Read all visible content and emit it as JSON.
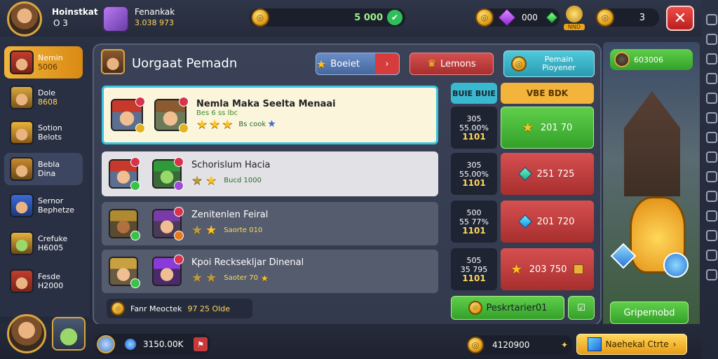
{
  "header": {
    "player_name": "Hoinstkat",
    "player_level": "O 3",
    "ally_name": "Fenankak",
    "ally_value": "3.038 973",
    "gold": "5 000",
    "gems": "000",
    "ticket_badge": "NND",
    "tokens": "3"
  },
  "sidebar": {
    "items": [
      {
        "label": "Nemin",
        "sub": "5006",
        "active": true
      },
      {
        "label": "Dole",
        "sub": "8608"
      },
      {
        "label": "Sotion",
        "sub": "Belots"
      },
      {
        "label": "Bebla",
        "sub": "Dina"
      },
      {
        "label": "Sernor",
        "sub": "Bephetze"
      },
      {
        "label": "Crefuke",
        "sub": "H6005"
      },
      {
        "label": "Fesde",
        "sub": "H2000"
      }
    ]
  },
  "panel": {
    "title": "Uorgaat Pemadn",
    "btn_select": "Boeiet",
    "btn_lemons": "Lemons",
    "btn_pemain": "Pemain Pioyener",
    "currency_right": "603006",
    "col_header_left": "BUIE BUIE",
    "col_header_right": "VBE BDK"
  },
  "rows": [
    {
      "title": "Nemla Maka Seelta Menaai",
      "sub": "Bes 6 ss lbc",
      "extra": "Bs cook",
      "stats": [
        "305",
        "55.00%",
        "1101"
      ],
      "price": "201 70",
      "stars": 3
    },
    {
      "title": "Schorislum Hacia",
      "sub": "",
      "extra": "Bucd 1000",
      "stats": [
        "305",
        "55.00%",
        "1101"
      ],
      "price": "251 725",
      "stars": 2
    },
    {
      "title": "Zenitenlen Feiral",
      "sub": "",
      "extra": "Saorte 010",
      "stats": [
        "500",
        "55 77%",
        "1101"
      ],
      "price": "201 720",
      "stars": 2
    },
    {
      "title": "Kpoi Recksekljar Dinenal",
      "sub": "",
      "extra": "Saoter 70",
      "stats": [
        "505",
        "35 795",
        "1101"
      ],
      "price": "203 750",
      "stars": 2
    }
  ],
  "footer_row": {
    "label": "Fanr Meoctek",
    "value": "97 25 Olde"
  },
  "purchase_btn": "Peskrtarier01",
  "side_btn": "Gripernobd",
  "bottom": {
    "resource": "3150.00K",
    "gold": "4120900",
    "claim_btn": "Naehekal Ctrte"
  },
  "colors": {
    "gold": "#ffd75a",
    "green": "#3fb43f",
    "red": "#c83a3a",
    "cyan": "#39b9cf"
  }
}
